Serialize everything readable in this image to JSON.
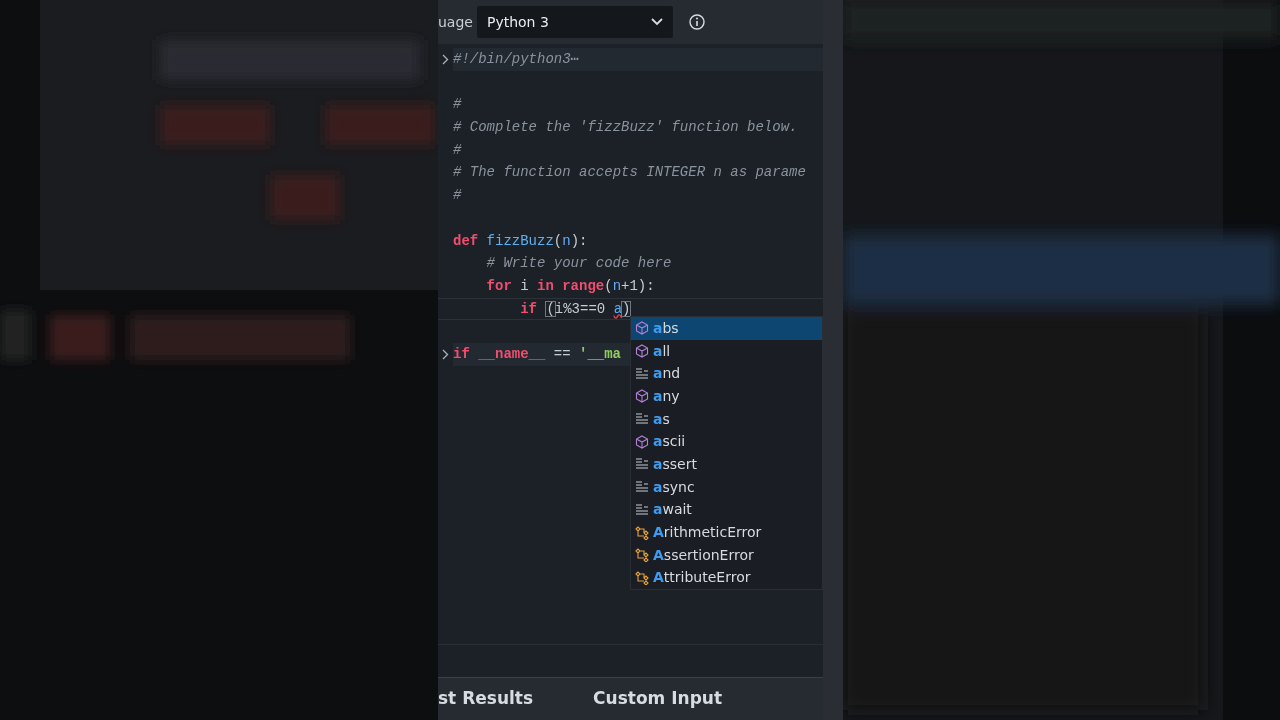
{
  "toolbar": {
    "label": "uage",
    "language": "Python 3"
  },
  "code_lines": [
    {
      "fold": true,
      "current": false,
      "words": [
        [
          {
            "kind": "comment",
            "text": "#!/bin/python3⋯"
          }
        ]
      ]
    },
    {
      "fold": false,
      "current": false
    },
    {
      "fold": false,
      "current": false,
      "words": [
        [
          {
            "kind": "comment",
            "text": "#"
          }
        ]
      ]
    },
    {
      "fold": false,
      "current": false,
      "words": [
        [
          {
            "kind": "comment",
            "text": "# Complete the 'fizzBuzz' function below."
          }
        ]
      ]
    },
    {
      "fold": false,
      "current": false,
      "words": [
        [
          {
            "kind": "comment",
            "text": "#"
          }
        ]
      ]
    },
    {
      "fold": false,
      "current": false,
      "words": [
        [
          {
            "kind": "comment",
            "text": "# The function accepts INTEGER n as parame"
          }
        ]
      ]
    },
    {
      "fold": false,
      "current": false,
      "words": [
        [
          {
            "kind": "comment",
            "text": "#"
          }
        ]
      ]
    },
    {
      "fold": false,
      "current": false
    },
    {
      "fold": false,
      "current": false,
      "words": [
        [
          {
            "kind": "keyword",
            "text": "def"
          }
        ],
        [
          {
            "kind": "function",
            "text": "fizzBuzz"
          },
          {
            "kind": "plain",
            "text": "("
          },
          {
            "kind": "param",
            "text": "n"
          },
          {
            "kind": "plain",
            "text": "):"
          }
        ]
      ],
      "children": [
        {
          "fold": false,
          "current": false,
          "words": [
            [
              {
                "kind": "comment",
                "text": "# Write your code here"
              }
            ]
          ]
        },
        {
          "fold": false,
          "current": false,
          "words": [
            [
              {
                "kind": "keyword",
                "text": "for"
              }
            ],
            [
              {
                "kind": "plain",
                "text": "i"
              }
            ],
            [
              {
                "kind": "keyword",
                "text": "in"
              }
            ],
            [
              {
                "kind": "keyword",
                "text": "range"
              },
              {
                "kind": "plain",
                "text": "("
              },
              {
                "kind": "param",
                "text": "n"
              },
              {
                "kind": "plain",
                "text": "+1):"
              }
            ]
          ],
          "children": [
            {
              "fold": false,
              "current": true,
              "words": [
                [
                  {
                    "kind": "keyword",
                    "text": "if"
                  }
                ],
                [
                  {
                    "kind": "bracket",
                    "text": "("
                  },
                  {
                    "kind": "plain",
                    "text": "i%3==0"
                  }
                ],
                [
                  {
                    "kind": "error",
                    "text": "a"
                  },
                  {
                    "kind": "bracket",
                    "text": ")"
                  }
                ]
              ]
            }
          ]
        }
      ]
    },
    {
      "fold": false,
      "current": false
    },
    {
      "fold": true,
      "current": false,
      "words": [
        [
          {
            "kind": "keyword",
            "text": "if"
          }
        ],
        [
          {
            "kind": "keyword",
            "text": "__name__"
          }
        ],
        [
          {
            "kind": "plain",
            "text": "=="
          }
        ],
        [
          {
            "kind": "string",
            "text": "'__ma"
          }
        ]
      ]
    }
  ],
  "suggestions": [
    {
      "kind": "function",
      "label": "**a**bs",
      "selected": true
    },
    {
      "kind": "function",
      "label": "**a**ll",
      "selected": false
    },
    {
      "kind": "keyword",
      "label": "**a**nd",
      "selected": false
    },
    {
      "kind": "function",
      "label": "**a**ny",
      "selected": false
    },
    {
      "kind": "keyword",
      "label": "**a**s",
      "selected": false
    },
    {
      "kind": "function",
      "label": "**a**scii",
      "selected": false
    },
    {
      "kind": "keyword",
      "label": "**a**ssert",
      "selected": false
    },
    {
      "kind": "keyword",
      "label": "**a**sync",
      "selected": false
    },
    {
      "kind": "keyword",
      "label": "**a**wait",
      "selected": false
    },
    {
      "kind": "class",
      "label": "**A**rithmeticError",
      "selected": false
    },
    {
      "kind": "class",
      "label": "**A**ssertionError",
      "selected": false
    },
    {
      "kind": "class",
      "label": "**A**ttributeError",
      "selected": false
    }
  ],
  "bottom_tabs": [
    {
      "label": "st Results"
    },
    {
      "label": "Custom Input"
    }
  ]
}
